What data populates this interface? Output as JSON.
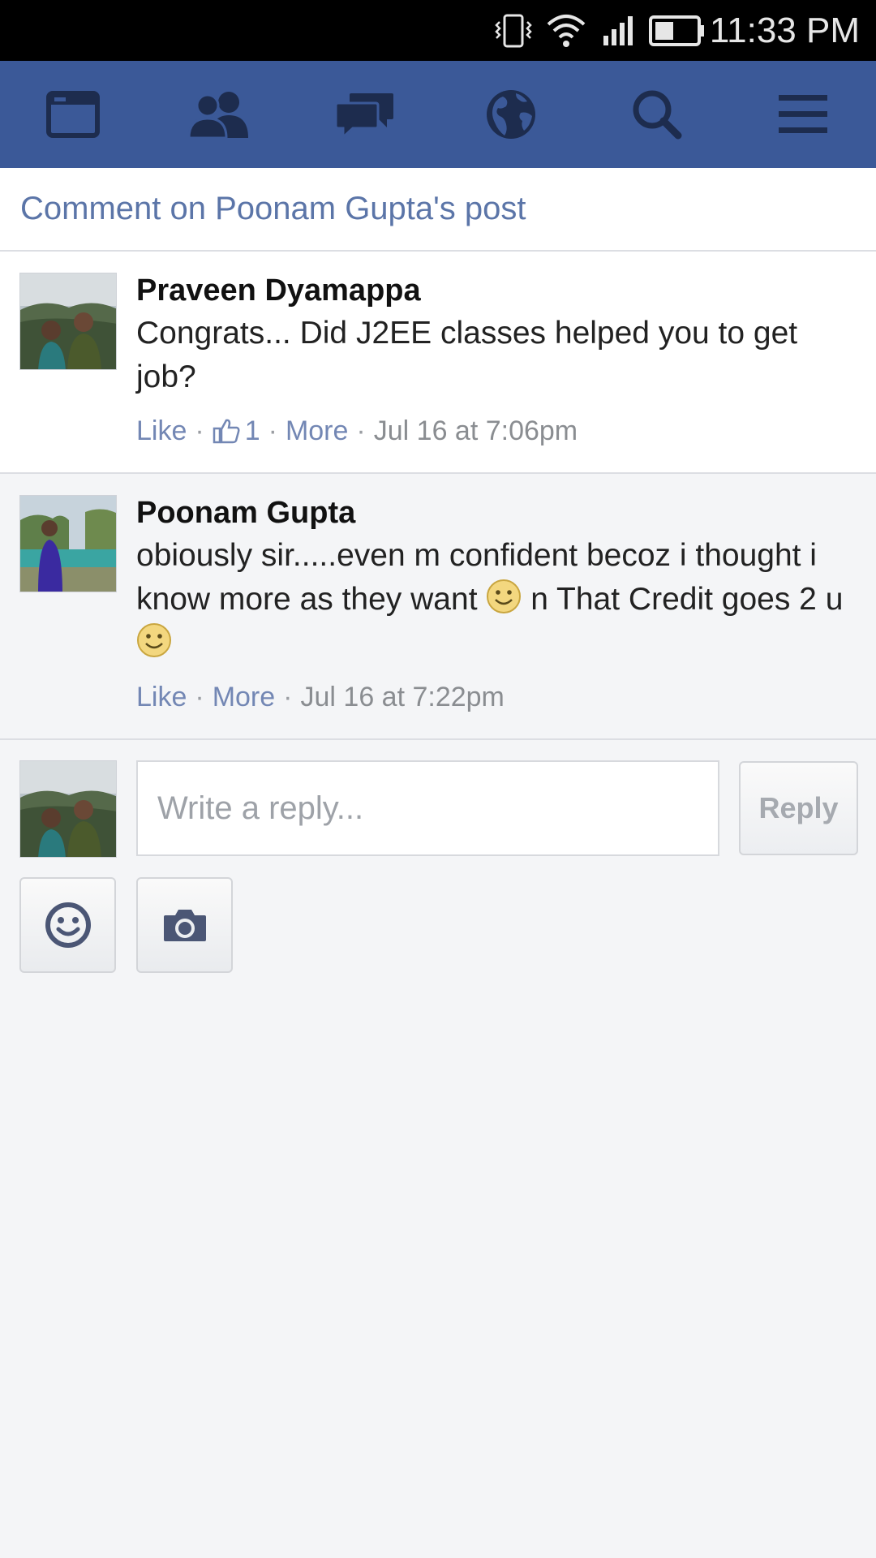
{
  "status_bar": {
    "time": "11:33 PM",
    "icons": [
      "vibrate-icon",
      "wifi-icon",
      "signal-icon",
      "battery-icon"
    ]
  },
  "navbar": {
    "items": [
      {
        "name": "news-feed-icon"
      },
      {
        "name": "friend-requests-icon"
      },
      {
        "name": "messages-icon"
      },
      {
        "name": "notifications-globe-icon"
      },
      {
        "name": "search-icon"
      },
      {
        "name": "menu-icon"
      }
    ],
    "color": "#3b5998"
  },
  "header": {
    "title": "Comment on Poonam Gupta's post"
  },
  "comments": [
    {
      "author": "Praveen Dyamappa",
      "text": "Congrats... Did J2EE classes helped you to get job?",
      "like_label": "Like",
      "like_count": "1",
      "more_label": "More",
      "timestamp": "Jul 16 at 7:06pm"
    },
    {
      "author": "Poonam Gupta",
      "text_part1": "obiously sir.....even m confident becoz i thought i know more as they want",
      "text_part2": "n That Credit goes 2 u",
      "like_label": "Like",
      "more_label": "More",
      "timestamp": "Jul 16 at 7:22pm"
    }
  ],
  "reply": {
    "placeholder": "Write a reply...",
    "button_label": "Reply"
  }
}
